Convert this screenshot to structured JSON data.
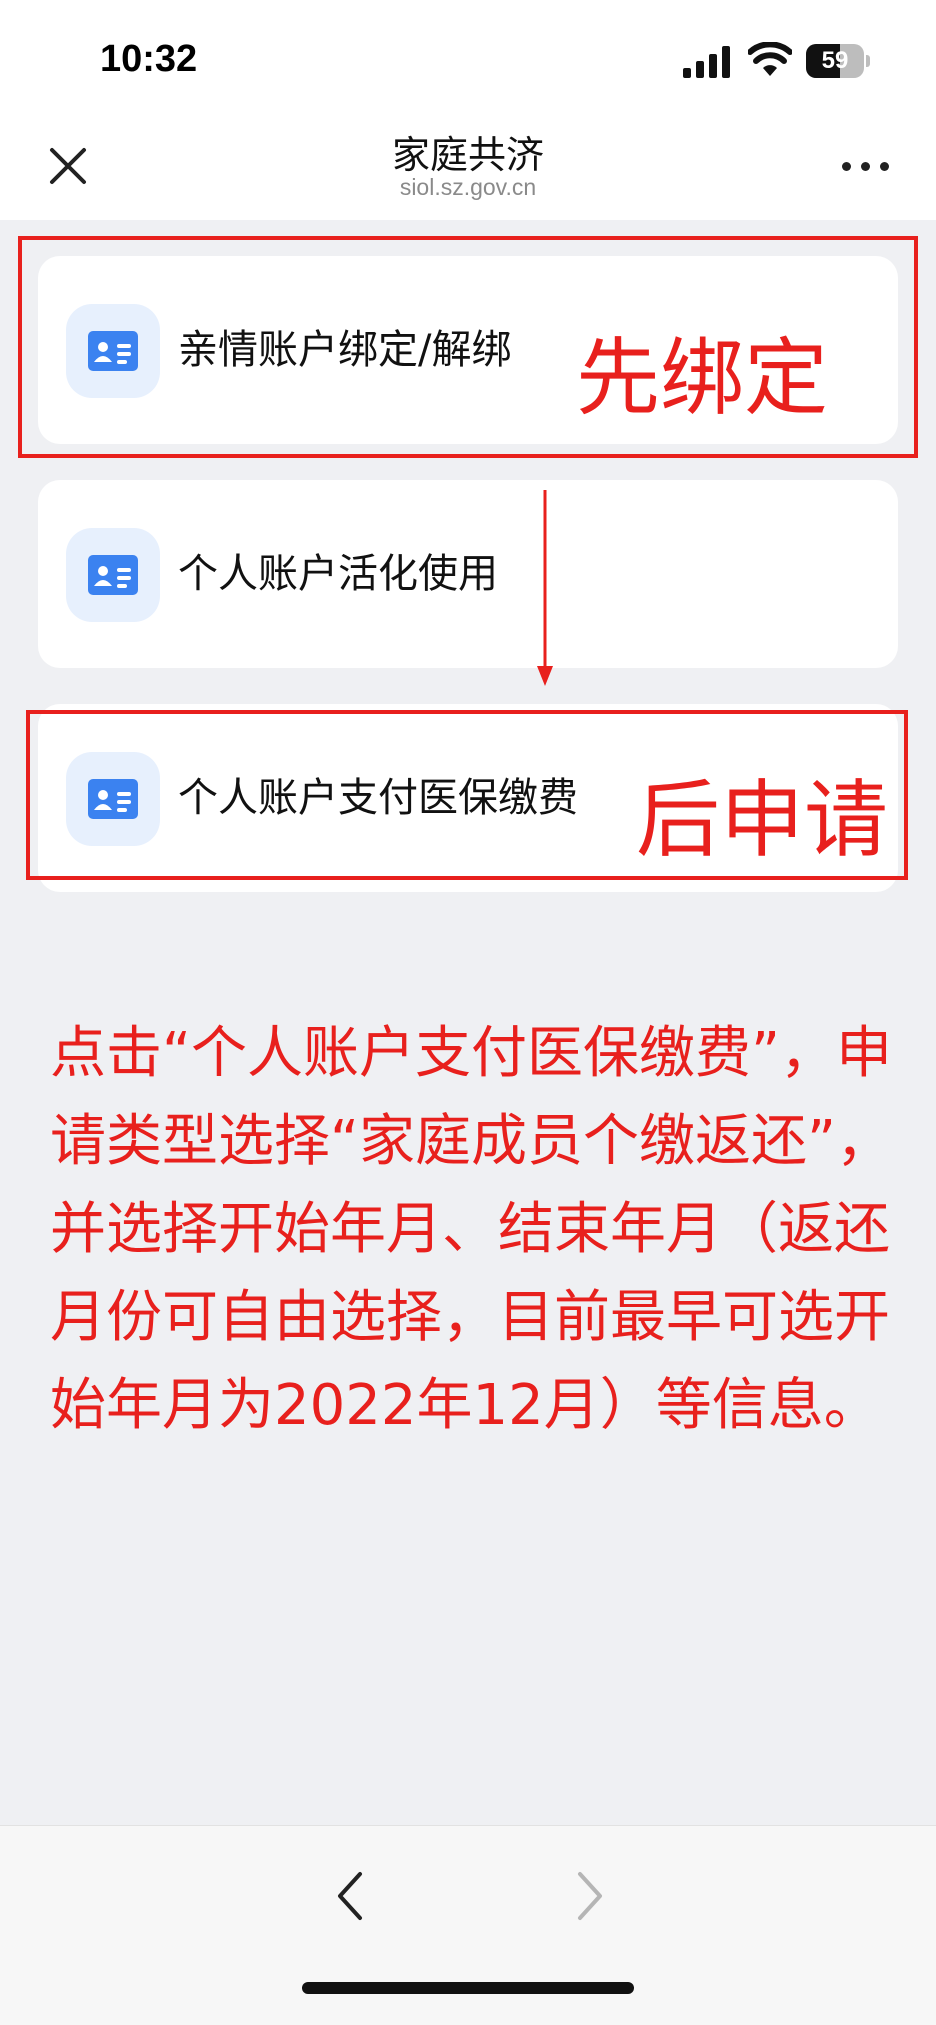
{
  "status_bar": {
    "time": "10:32",
    "battery": "59",
    "battery_level": 0.59,
    "icons": [
      "signal-icon",
      "wifi-icon",
      "battery-icon"
    ]
  },
  "nav": {
    "title": "家庭共济",
    "subtitle": "siol.sz.gov.cn",
    "left_icon": "close-icon",
    "right_icon": "more-icon"
  },
  "menu": {
    "items": [
      {
        "label": "亲情账户绑定/解绑",
        "icon": "id-card-icon"
      },
      {
        "label": "个人账户活化使用",
        "icon": "id-card-icon"
      },
      {
        "label": "个人账户支付医保缴费",
        "icon": "id-card-icon"
      }
    ]
  },
  "annotations": {
    "first_step": "先绑定",
    "second_step": "后申请",
    "instruction": "点击“个人账户支付医保缴费”，申请类型选择“家庭成员个缴返还”，并选择开始年月、结束年月（返还月份可自由选择，目前最早可选开始年月为2022年12月）等信息。"
  },
  "toolbar": {
    "back_icon": "chevron-left-icon",
    "forward_icon": "chevron-right-icon"
  },
  "colors": {
    "annotation_red": "#e8201d",
    "icon_blue": "#3b82f0",
    "icon_bg": "#e7f0fd",
    "page_bg": "#eff0f3"
  }
}
